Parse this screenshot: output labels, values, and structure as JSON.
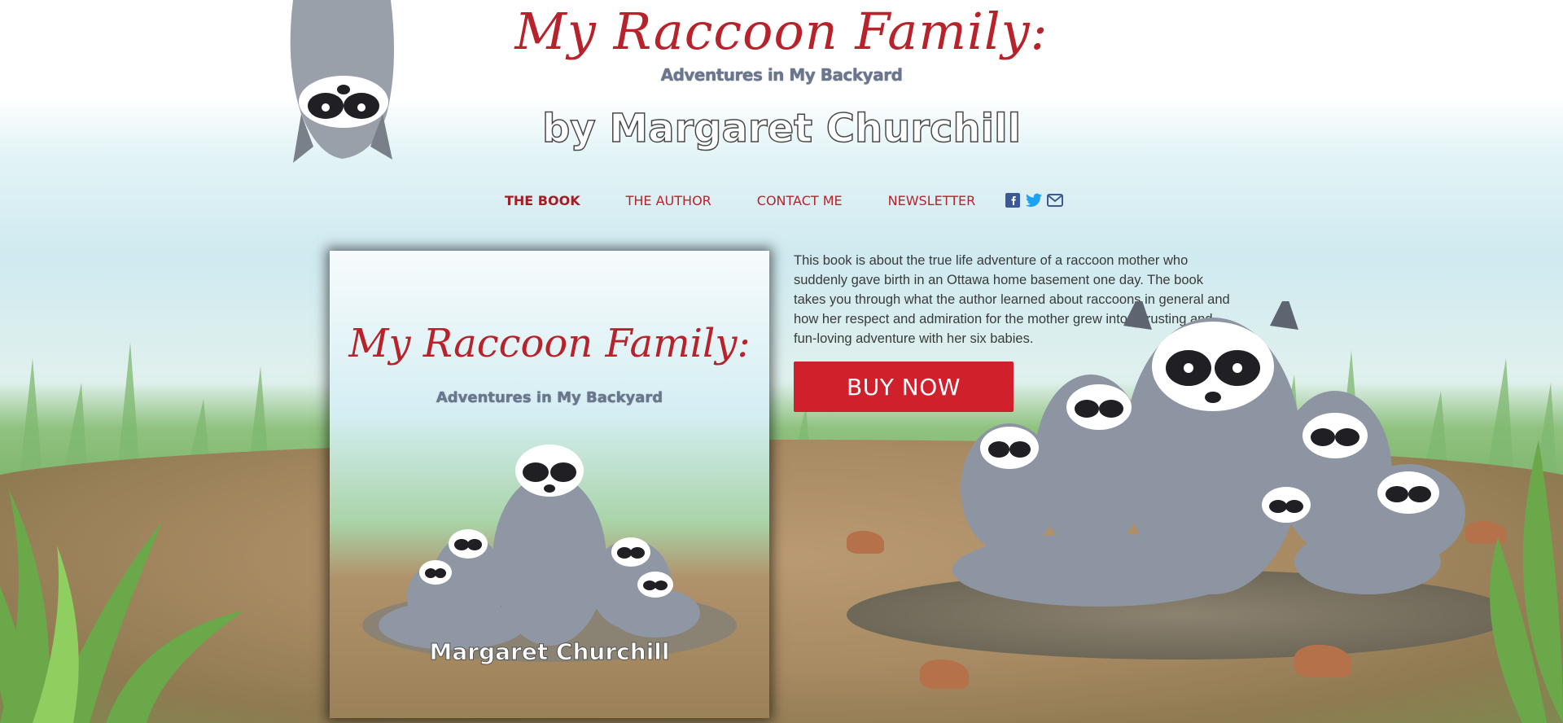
{
  "header": {
    "title": "My Raccoon Family:",
    "subtitle": "Adventures in My Backyard",
    "author_line": "by Margaret Churchill"
  },
  "nav": {
    "items": [
      {
        "label": "THE BOOK",
        "active": true
      },
      {
        "label": "THE AUTHOR",
        "active": false
      },
      {
        "label": "CONTACT ME",
        "active": false
      },
      {
        "label": "NEWSLETTER",
        "active": false
      }
    ],
    "social_icons": [
      "facebook-icon",
      "twitter-icon",
      "envelope-icon"
    ]
  },
  "cover": {
    "title": "My Raccoon Family:",
    "subtitle": "Adventures in My Backyard",
    "author": "Margaret Churchill"
  },
  "description": "This book is about the true life adventure of a raccoon mother who suddenly gave birth in an Ottawa home basement one day. The book takes you through what the author learned about raccoons in general and how her respect and admiration for the mother grew into a trusting and fun-loving adventure with her six babies.",
  "buy_button": "BUY NOW",
  "colors": {
    "brand_red": "#b8232b",
    "button_red": "#d0202b",
    "facebook": "#3b5998",
    "twitter": "#1da1f2",
    "envelope": "#3b5998"
  }
}
